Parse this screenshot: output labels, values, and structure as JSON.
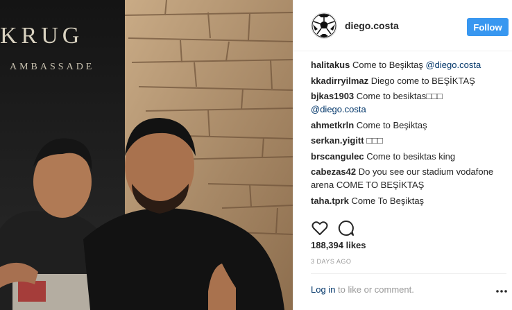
{
  "photo": {
    "sign_line1": "KRUG",
    "sign_line2": "AMBASSADE"
  },
  "header": {
    "username": "diego.costa",
    "follow_label": "Follow",
    "avatar_icon": "soccer-ball-icon"
  },
  "comments": [
    {
      "user": "halitakus",
      "text": "Come to Beşiktaş ",
      "mention": "@diego.costa"
    },
    {
      "user": "kkadirryilmaz",
      "text": "Diego come to BEŞİKTAŞ",
      "mention": ""
    },
    {
      "user": "bjkas1903",
      "text": "Come to besiktas□□□ ",
      "mention": "@diego.costa"
    },
    {
      "user": "ahmetkrln",
      "text": "Come to Beşiktaş",
      "mention": ""
    },
    {
      "user": "serkan.yigitt",
      "text": "□□□",
      "mention": ""
    },
    {
      "user": "brscangulec",
      "text": "Come to besiktas king",
      "mention": ""
    },
    {
      "user": "cabezas42",
      "text": "Do you see our stadium vodafone arena COME TO BEŞİKTAŞ",
      "mention": ""
    },
    {
      "user": "taha.tprk",
      "text": "Come To Beşiktaş",
      "mention": ""
    }
  ],
  "actions": {
    "like_icon": "heart-icon",
    "comment_icon": "comment-bubble-icon"
  },
  "likes": "188,394 likes",
  "timestamp": "3 DAYS AGO",
  "footer": {
    "login_link": "Log in",
    "login_rest": " to like or comment.",
    "more_icon": "more-options-icon"
  },
  "colors": {
    "follow_bg": "#3897f0",
    "mention": "#003569",
    "muted": "#999999"
  }
}
